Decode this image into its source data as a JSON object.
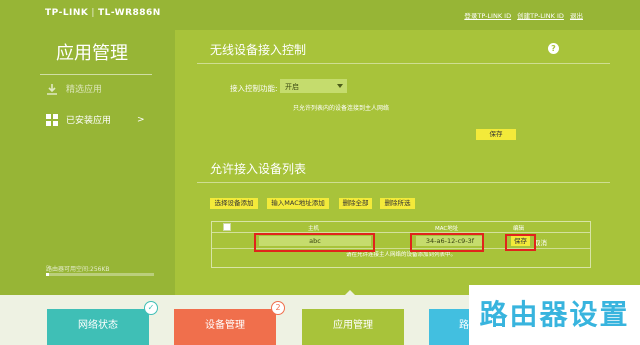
{
  "header": {
    "brand": "TP-LINK",
    "model": "TL-WR886N",
    "links": [
      "登录TP-LINK ID",
      "创建TP-LINK ID",
      "退出"
    ]
  },
  "sidebar": {
    "title": "应用管理",
    "items": [
      {
        "label": "精选应用",
        "icon": "download-icon"
      },
      {
        "label": "已安装应用",
        "icon": "windows-grid-icon",
        "suffix": ">"
      }
    ],
    "storage_label": "路由器可用空间:256KB"
  },
  "access_control": {
    "title": "无线设备接入控制",
    "help": "?",
    "function_label": "接入控制功能:",
    "function_value": "开启",
    "hint": "只允许列表内的设备连接到主人网络",
    "save_label": "保存"
  },
  "allow_list": {
    "title": "允许接入设备列表",
    "buttons": [
      "选择设备添加",
      "输入MAC地址添加",
      "删除全部",
      "删除所选"
    ],
    "columns": [
      "主机",
      "MAC地址",
      "编辑"
    ],
    "row": {
      "host": "abc",
      "mac": "34-a6-12-c9-3f",
      "save": "保存",
      "cancel": "取消"
    },
    "note": "请在允许连接主人网络的设备添加到列表中。"
  },
  "bottom_tabs": [
    {
      "label": "网络状态",
      "color": "#3fbfb6",
      "badge": "✓"
    },
    {
      "label": "设备管理",
      "color": "#f06f4c",
      "badge": "2"
    },
    {
      "label": "应用管理",
      "color": "#a8c33a",
      "badge": ""
    },
    {
      "label": "路",
      "color": "#42bfe0",
      "badge": ""
    }
  ],
  "watermark": "路由器设置",
  "colors": {
    "primary": "#a8c33a",
    "sidebar": "#97b536",
    "button": "#f3ea3a",
    "highlight": "#e0241b"
  }
}
